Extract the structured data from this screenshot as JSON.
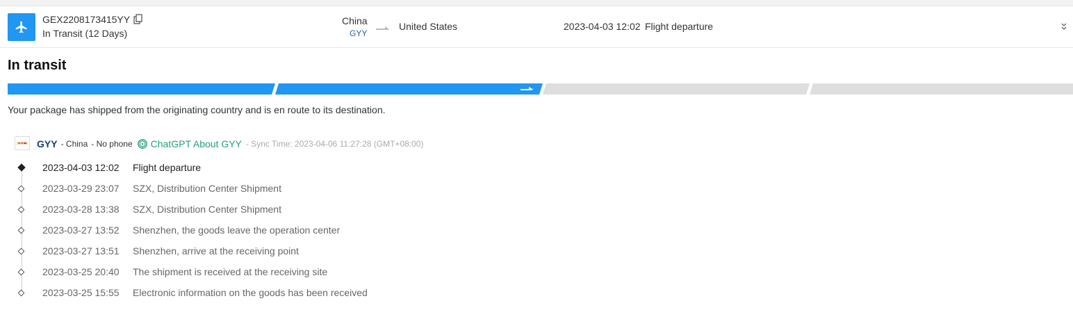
{
  "header": {
    "tracking_number": "GEX2208173415YY",
    "status_line": "In Transit (12 Days)",
    "origin_country": "China",
    "origin_code": "GYY",
    "destination_country": "United States",
    "latest_event_time": "2023-04-03 12:02",
    "latest_event_desc": "Flight departure",
    "icons": {
      "plane": "airplane-icon",
      "copy": "copy-icon",
      "arrow": "route-arrow-icon",
      "collapse": "collapse-chevron-icon"
    }
  },
  "status": {
    "title": "In transit",
    "description": "Your package has shipped from the originating country and is en route to its destination.",
    "progress_steps_total": 4,
    "progress_steps_completed": 2,
    "progress_active_color": "#2196f3",
    "progress_inactive_color": "#dedede"
  },
  "carrier": {
    "name": "GYY",
    "country": "- China",
    "phone": "- No phone",
    "chatgpt_label": "ChatGPT About GYY",
    "sync_text": "- Sync Time: 2023-04-06 11:27:28 (GMT+08:00)",
    "chatgpt_color": "#1fa37a"
  },
  "events": [
    {
      "time": "2023-04-03 12:02",
      "desc": "Flight departure"
    },
    {
      "time": "2023-03-29 23:07",
      "desc": "SZX, Distribution Center Shipment"
    },
    {
      "time": "2023-03-28 13:38",
      "desc": "SZX, Distribution Center Shipment"
    },
    {
      "time": "2023-03-27 13:52",
      "desc": "Shenzhen, the goods leave the operation center"
    },
    {
      "time": "2023-03-27 13:51",
      "desc": "Shenzhen, arrive at the receiving point"
    },
    {
      "time": "2023-03-25 20:40",
      "desc": "The shipment is received at the receiving site"
    },
    {
      "time": "2023-03-25 15:55",
      "desc": "Electronic information on the goods has been received"
    }
  ]
}
